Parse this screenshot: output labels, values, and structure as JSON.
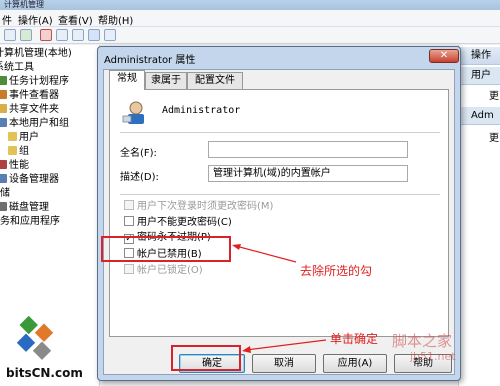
{
  "window": {
    "title": "计算机管理"
  },
  "menu": [
    "操作(A)",
    "查看(V)",
    "帮助(H)"
  ],
  "tree": [
    {
      "label": "计算机管理(本地)",
      "color": "#6b8fc2"
    },
    {
      "label": "系统工具",
      "color": "#6b8fc2"
    },
    {
      "label": "任务计划程序",
      "color": "#4e8b3a"
    },
    {
      "label": "事件查看器",
      "color": "#c87b2a"
    },
    {
      "label": "共享文件夹",
      "color": "#d8b04a"
    },
    {
      "label": "本地用户和组",
      "color": "#5a7fb5"
    },
    {
      "label": "用户",
      "color": "#e3c25a"
    },
    {
      "label": "组",
      "color": "#e3c25a"
    },
    {
      "label": "性能",
      "color": "#b04040"
    },
    {
      "label": "设备管理器",
      "color": "#5a7fb5"
    },
    {
      "label": "存储",
      "color": "#8a8a8a"
    },
    {
      "label": "磁盘管理",
      "color": "#6f6f6f"
    },
    {
      "label": "服务和应用程序",
      "color": "#6f6f6f"
    }
  ],
  "actions": {
    "header1": "操作",
    "sub1": "用户",
    "item1": "更",
    "header2": "Adm",
    "item2": "更"
  },
  "dialog": {
    "title": "Administrator 属性",
    "close": "✕",
    "tabs": [
      "常规",
      "隶属于",
      "配置文件"
    ],
    "username": "Administrator",
    "fullname_label": "全名(F):",
    "fullname_value": "",
    "desc_label": "描述(D):",
    "desc_value": "管理计算机(域)的内置帐户",
    "checkboxes": [
      {
        "label": "用户下次登录时须更改密码(M)",
        "checked": false,
        "disabled": true
      },
      {
        "label": "用户不能更改密码(C)",
        "checked": false,
        "disabled": false
      },
      {
        "label": "密码永不过期(P)",
        "checked": true,
        "disabled": false
      },
      {
        "label": "帐户已禁用(B)",
        "checked": false,
        "disabled": false
      },
      {
        "label": "帐户已锁定(O)",
        "checked": false,
        "disabled": true
      }
    ],
    "buttons": {
      "ok": "确定",
      "cancel": "取消",
      "apply": "应用(A)",
      "help": "帮助"
    }
  },
  "annotations": {
    "remove_check": "去除所选的勾",
    "click_ok": "单击确定",
    "color": "#e02020"
  },
  "watermark": {
    "logo": "bitsCN.com",
    "site1": "脚本之家",
    "site2": "jb51.net"
  }
}
